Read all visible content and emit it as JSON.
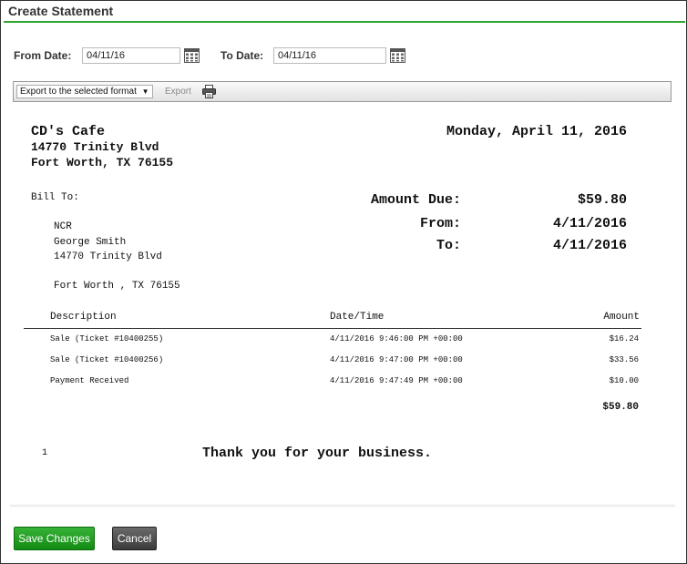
{
  "dialog": {
    "title": "Create Statement"
  },
  "filters": {
    "from_label": "From Date:",
    "from_value": "04/11/16",
    "to_label": "To Date:",
    "to_value": "04/11/16"
  },
  "toolbar": {
    "export_format": "Export to the selected format",
    "export_label": "Export"
  },
  "statement": {
    "business_name": "CD's Cafe",
    "business_address1": "14770 Trinity Blvd",
    "business_address2": "Fort Worth, TX 76155",
    "date": "Monday, April 11, 2016",
    "bill_to_label": "Bill To:",
    "bill_to": {
      "company": "NCR",
      "name": "George Smith",
      "address1": "14770 Trinity Blvd",
      "address2": "Fort Worth , TX 76155"
    },
    "amount_due_label": "Amount Due:",
    "amount_due": "$59.80",
    "from_label": "From:",
    "from_date": "4/11/2016",
    "to_label": "To:",
    "to_date": "4/11/2016",
    "columns": {
      "description": "Description",
      "datetime": "Date/Time",
      "amount": "Amount"
    },
    "rows": [
      {
        "description": "Sale (Ticket #10400255)",
        "datetime": "4/11/2016 9:46:00 PM +00:00",
        "amount": "$16.24"
      },
      {
        "description": "Sale (Ticket #10400256)",
        "datetime": "4/11/2016 9:47:00 PM +00:00",
        "amount": "$33.56"
      },
      {
        "description": "Payment Received",
        "datetime": "4/11/2016 9:47:49 PM +00:00",
        "amount": "$10.00"
      }
    ],
    "total": "$59.80",
    "page_number": "1",
    "thank_you": "Thank you for your business."
  },
  "buttons": {
    "save": "Save Changes",
    "cancel": "Cancel"
  },
  "colors": {
    "accent": "#2ea42e",
    "save_button": "#1e9a1e",
    "cancel_button": "#4a4a4a"
  },
  "icons": {
    "calendar": "calendar-icon",
    "print": "printer-icon",
    "dropdown": "caret-down-icon"
  }
}
